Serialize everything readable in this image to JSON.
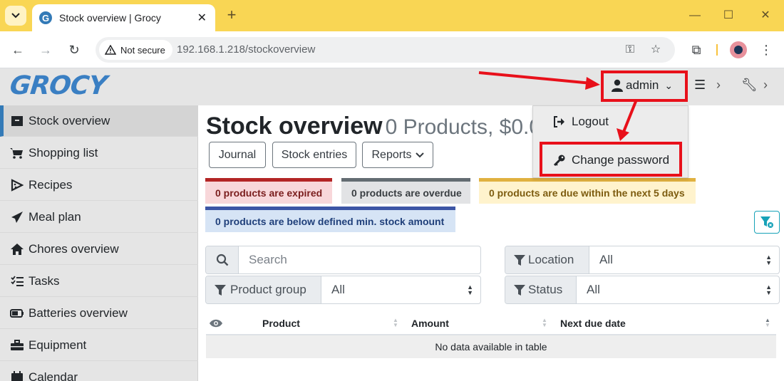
{
  "browser": {
    "tab_title": "Stock overview | Grocy",
    "favicon_letter": "G",
    "security_label": "Not secure",
    "url": "192.168.1.218/stockoverview"
  },
  "app": {
    "logo": "GROCY",
    "user_menu_label": "admin",
    "user_dropdown": [
      {
        "label": "Logout",
        "icon": "logout-icon"
      },
      {
        "label": "Change password",
        "icon": "key-icon"
      }
    ]
  },
  "sidebar": {
    "items": [
      {
        "label": "Stock overview",
        "icon": "box-icon",
        "active": true
      },
      {
        "label": "Shopping list",
        "icon": "cart-icon"
      },
      {
        "label": "Recipes",
        "icon": "pizza-icon"
      },
      {
        "label": "Meal plan",
        "icon": "paper-plane-icon"
      },
      {
        "label": "Chores overview",
        "icon": "home-icon"
      },
      {
        "label": "Tasks",
        "icon": "tasks-icon"
      },
      {
        "label": "Batteries overview",
        "icon": "battery-icon"
      },
      {
        "label": "Equipment",
        "icon": "toolbox-icon"
      },
      {
        "label": "Calendar",
        "icon": "calendar-icon"
      }
    ]
  },
  "main": {
    "title": "Stock overview",
    "subtitle": "0 Products, $0.0",
    "buttons": {
      "journal": "Journal",
      "stock_entries": "Stock entries",
      "reports": "Reports"
    },
    "notices": {
      "expired": "0 products are expired",
      "overdue": "0 products are overdue",
      "due_soon": "0 products are due within the next 5 days",
      "below_min": "0 products are below defined min. stock amount"
    },
    "filters": {
      "search_placeholder": "Search",
      "location_label": "Location",
      "location_value": "All",
      "product_group_label": "Product group",
      "product_group_value": "All",
      "status_label": "Status",
      "status_value": "All"
    },
    "table": {
      "columns": [
        "Product",
        "Amount",
        "Next due date"
      ],
      "empty_message": "No data available in table"
    }
  },
  "colors": {
    "annotation": "#e8101a",
    "accent": "#337ab7",
    "expired": "#b32525",
    "overdue": "#636c72",
    "due_soon": "#e0b140",
    "below_min": "#3c55a5"
  }
}
